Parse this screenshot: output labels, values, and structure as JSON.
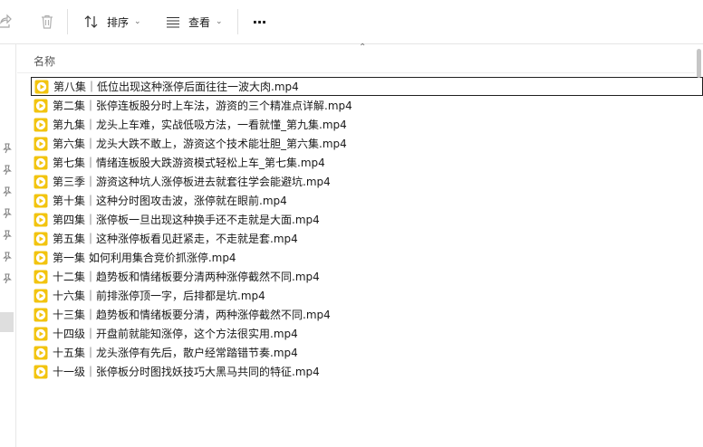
{
  "toolbar": {
    "sort_label": "排序",
    "view_label": "查看",
    "more_label": "···"
  },
  "header": {
    "name_column": "名称"
  },
  "files": [
    "第八集｜低位出现这种涨停后面往往一波大肉.mp4",
    "第二集｜张停连板股分时上车法，游资的三个精准点详解.mp4",
    "第九集｜龙头上车难，实战低吸方法，一看就懂_第九集.mp4",
    "第六集｜龙头大跌不敢上，游资这个技术能壮胆_第六集.mp4",
    "第七集｜情绪连板股大跌游资模式轻松上车_第七集.mp4",
    "第三季｜游资这种坑人涨停板进去就套往学会能避坑.mp4",
    "第十集｜这种分时图攻击波，涨停就在眼前.mp4",
    "第四集｜涨停板一旦出现这种换手还不走就是大面.mp4",
    "第五集｜这种涨停板看见赶紧走，不走就是套.mp4",
    "第一集   如何利用集合竞价抓涨停.mp4",
    "十二集｜趋势板和情绪板要分清两种涨停截然不同.mp4",
    "十六集｜前排涨停顶一字，后排都是坑.mp4",
    "十三集｜趋势板和情绪板要分清，两种涨停截然不同.mp4",
    "十四级｜开盘前就能知涨停，这个方法很实用.mp4",
    "十五集｜龙头涨停有先后，散户经常踏错节奏.mp4",
    "十一级｜张停板分时图找妖技巧大黑马共同的特征.mp4"
  ],
  "colors": {
    "video_icon": "#f2c40f",
    "selection_border": "#1f1f1f",
    "nav_selected": "#dedede"
  }
}
